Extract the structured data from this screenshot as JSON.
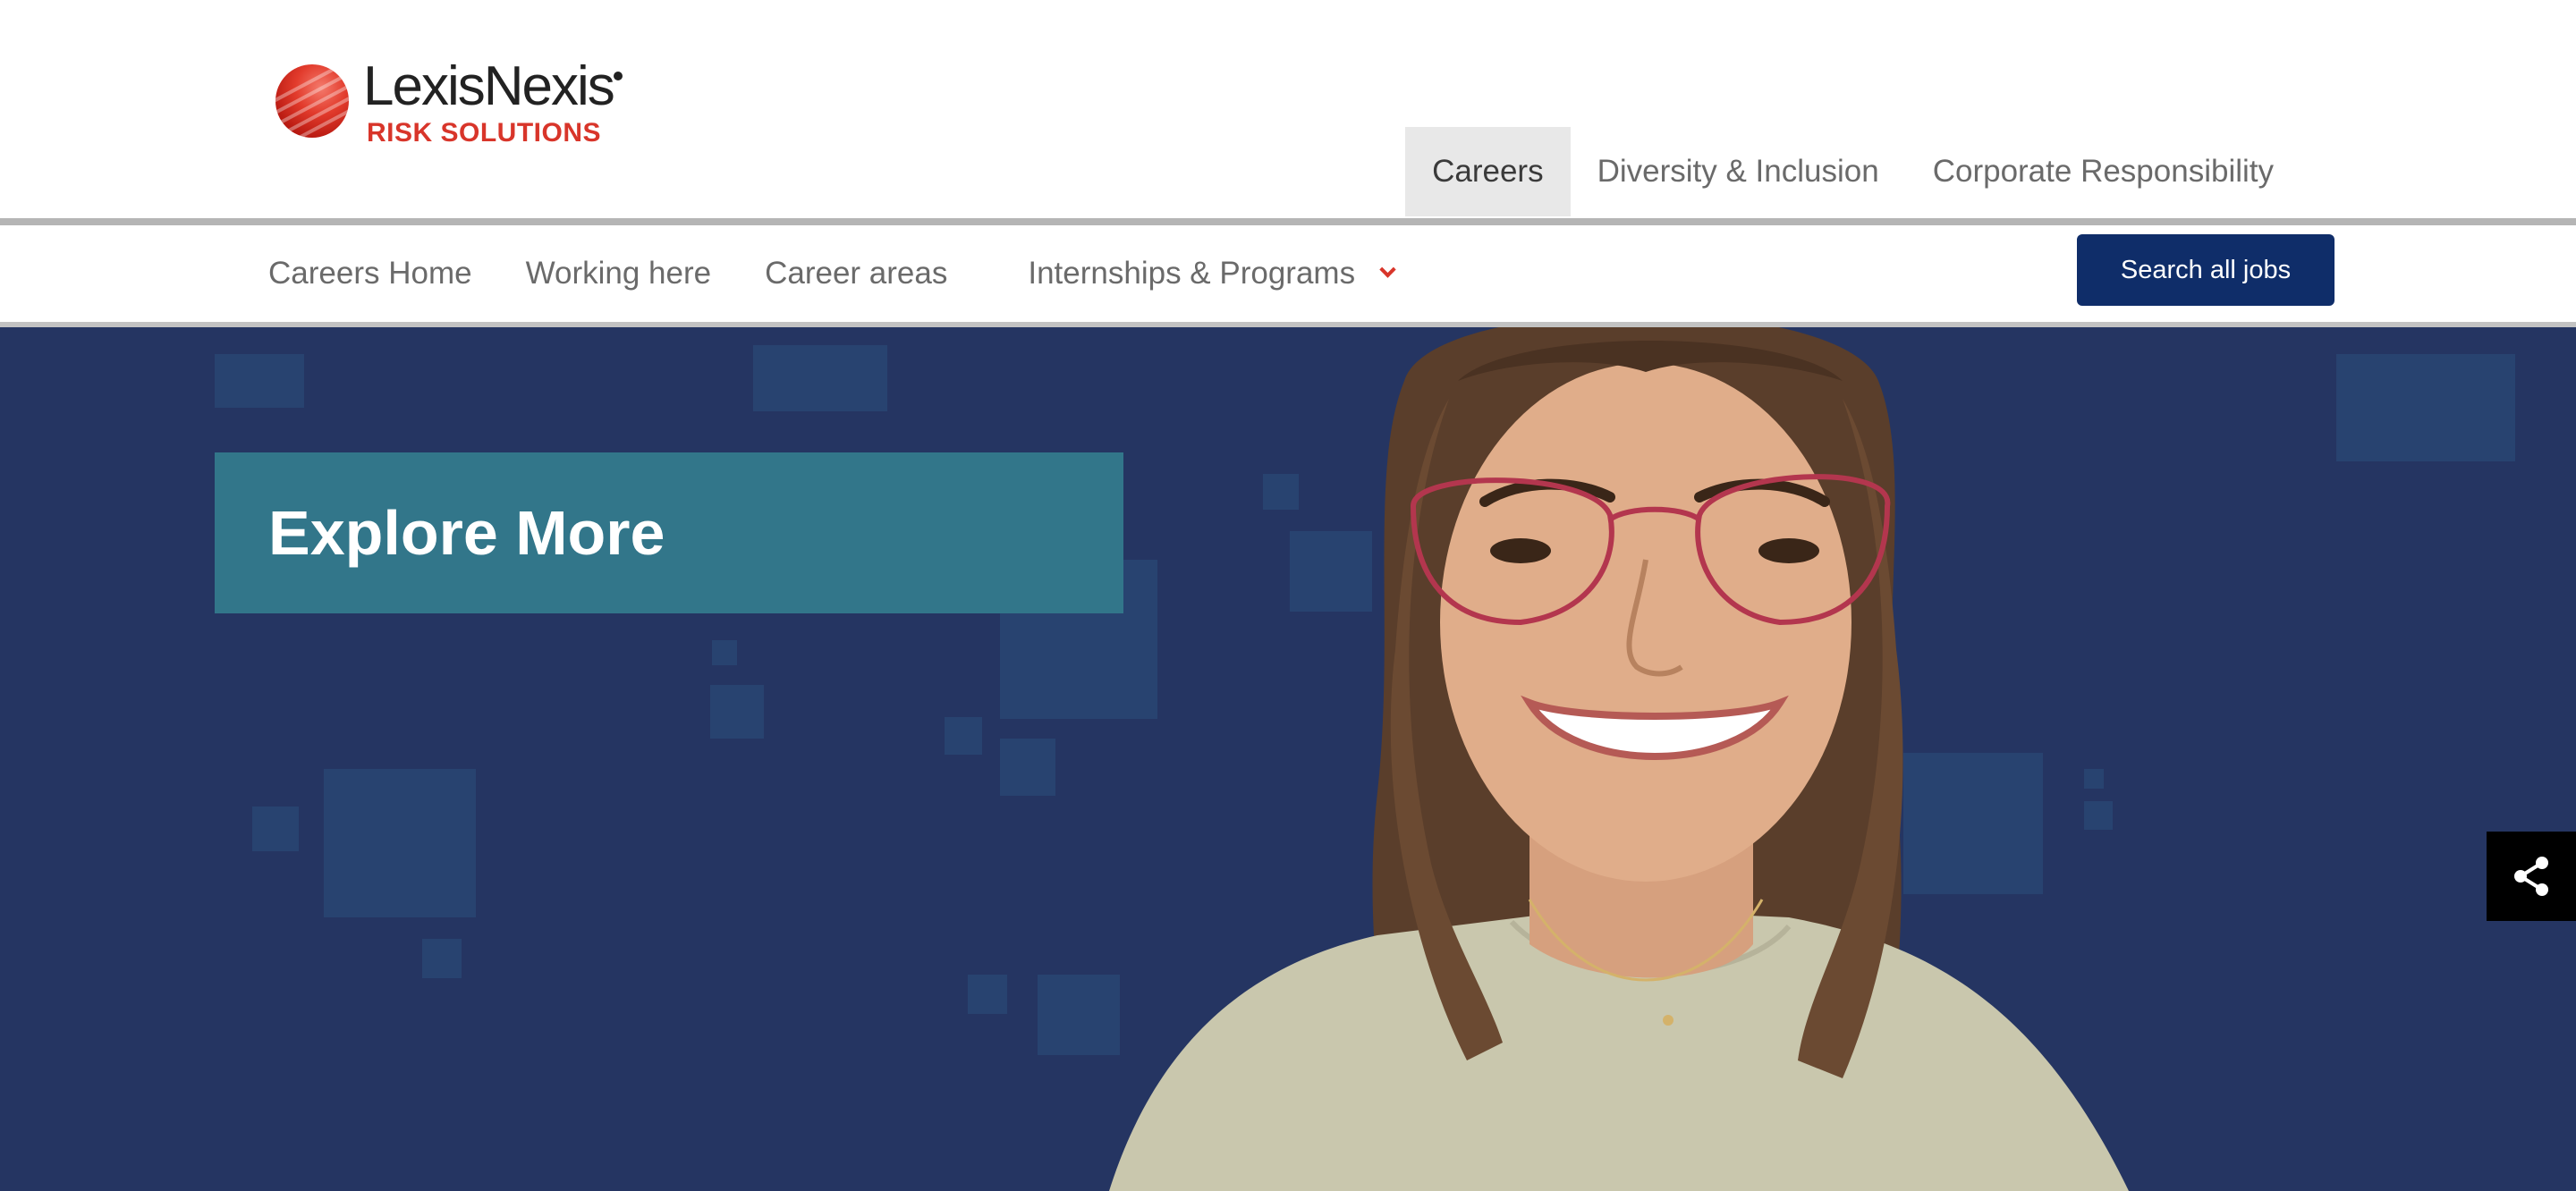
{
  "brand": {
    "name": "LexisNexis",
    "subtitle": "RISK SOLUTIONS",
    "accent_color": "#d8352a"
  },
  "top_nav": {
    "items": [
      {
        "label": "Careers",
        "active": true
      },
      {
        "label": "Diversity & Inclusion",
        "active": false
      },
      {
        "label": "Corporate Responsibility",
        "active": false
      }
    ]
  },
  "sub_nav": {
    "items": [
      {
        "label": "Careers Home"
      },
      {
        "label": "Working here"
      },
      {
        "label": "Career areas"
      },
      {
        "label": "Internships & Programs",
        "has_dropdown": true
      }
    ],
    "search_button_label": "Search all jobs",
    "button_color": "#0f2d69"
  },
  "hero": {
    "heading": "Explore More",
    "background_color": "#253562",
    "heading_box_color": "#32768a"
  },
  "share": {
    "icon": "share-icon"
  }
}
